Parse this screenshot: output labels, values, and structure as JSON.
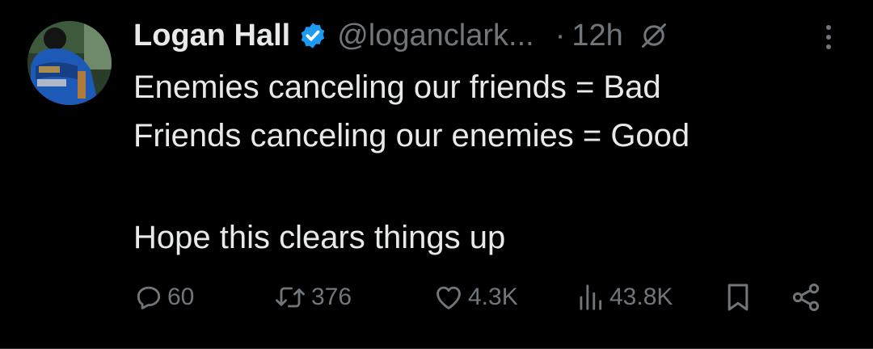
{
  "tweet": {
    "author_name": "Logan Hall",
    "handle": "@loganclark...",
    "separator": "·",
    "time": "12h",
    "lines": [
      "Enemies canceling our friends = Bad",
      "Friends canceling our enemies = Good",
      "Hope this clears things up"
    ]
  },
  "actions": {
    "replies": "60",
    "reposts": "376",
    "likes": "4.3K",
    "views": "43.8K"
  },
  "icons": {
    "verified": "verified-badge-icon",
    "grok": "grok-icon",
    "more": "more-vertical-icon",
    "reply": "reply-icon",
    "repost": "repost-icon",
    "like": "heart-icon",
    "views": "views-chart-icon",
    "bookmark": "bookmark-icon",
    "share": "share-icon"
  },
  "colors": {
    "background": "#000000",
    "text": "#e7e9ea",
    "muted": "#71767b",
    "verified": "#1d9bf0"
  }
}
